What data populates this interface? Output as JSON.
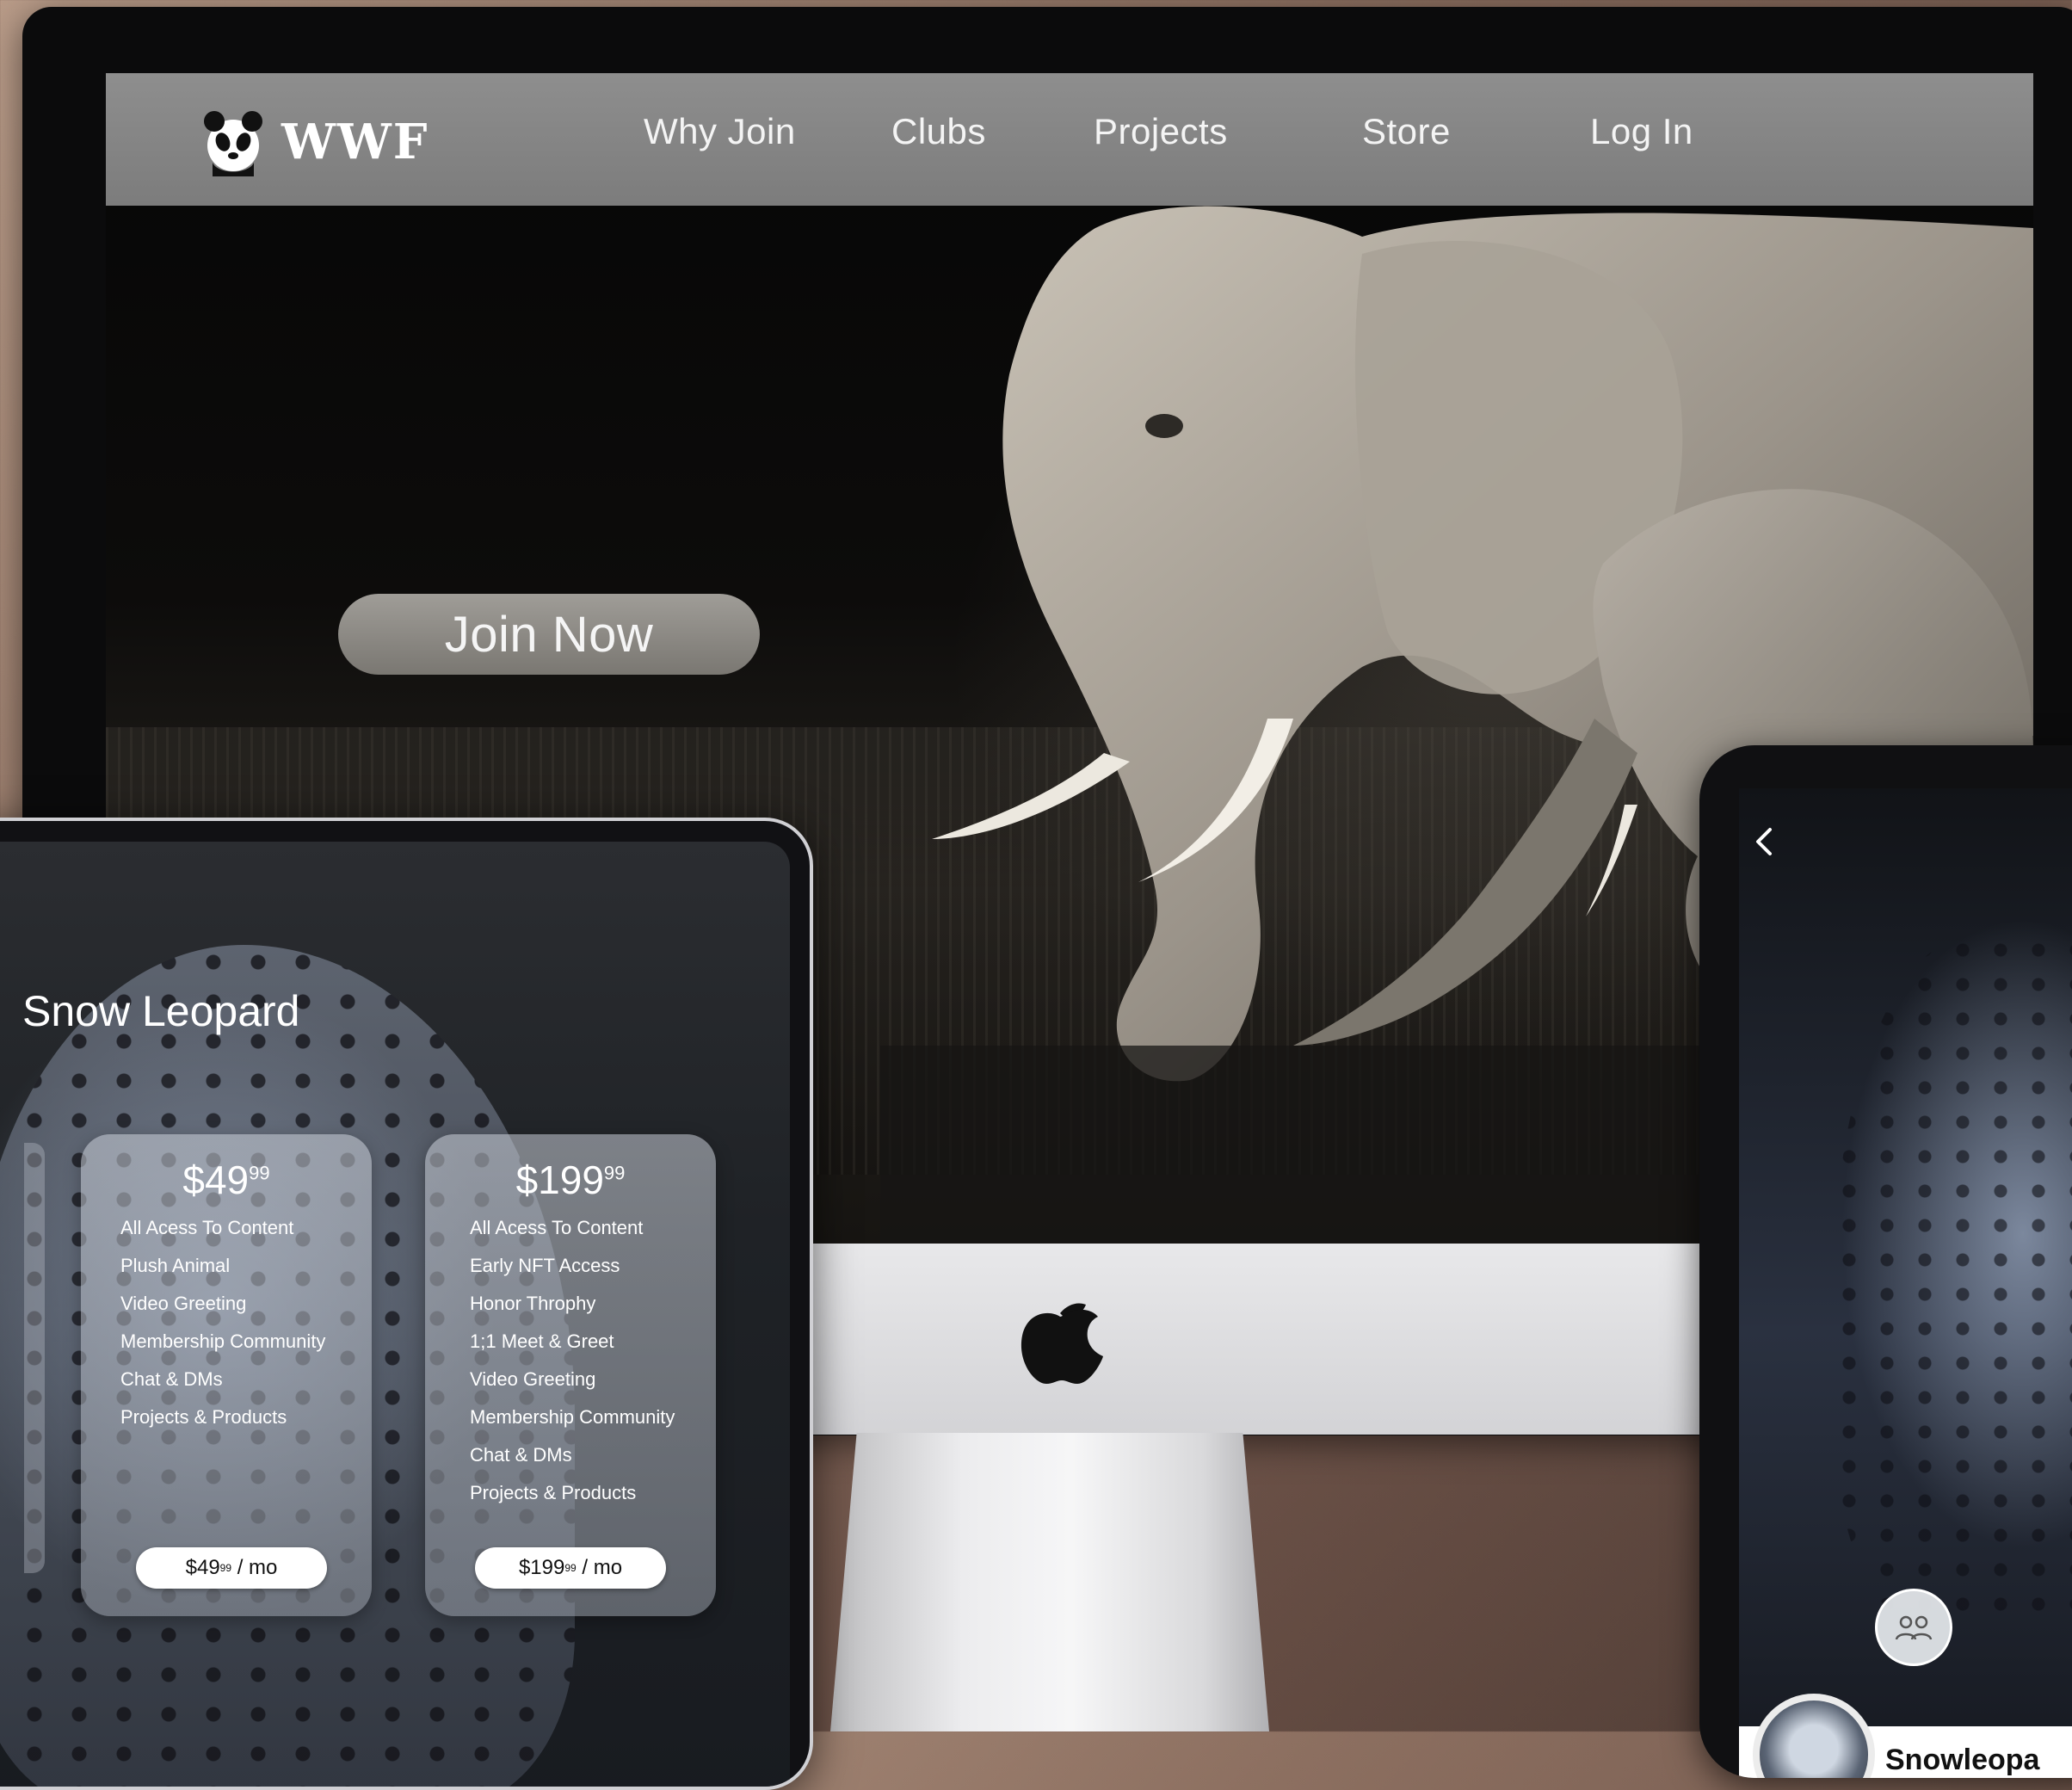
{
  "desktop": {
    "brand": "WWF",
    "nav": [
      "Why Join",
      "Clubs",
      "Projects",
      "Store",
      "Log In"
    ],
    "hero_button": "Join Now"
  },
  "tablet": {
    "title": "Snow Leopard",
    "plans": [
      {
        "price_main": "$49",
        "price_cents": "99",
        "features": [
          "All Acess To Content",
          "Plush Animal",
          "Video Greeting",
          "Membership Community",
          "Chat & DMs",
          "Projects & Products"
        ],
        "cta_main": "$49",
        "cta_cents": "99",
        "cta_suffix": " / mo"
      },
      {
        "price_main": "$199",
        "price_cents": "99",
        "features": [
          "All Acess To Content",
          "Early NFT Access",
          "Honor Throphy",
          "1;1 Meet & Greet",
          "Video Greeting",
          "Membership Community",
          "Chat & DMs",
          "Projects & Products"
        ],
        "cta_main": "$199",
        "cta_cents": "99",
        "cta_suffix": " / mo"
      }
    ]
  },
  "phone": {
    "profile_name": "Snowleopa",
    "icons": [
      "chevron-left-icon",
      "group-icon",
      "chat-icon"
    ]
  },
  "colors": {
    "background": "#8c6f60",
    "navbar": "#8e8e8e",
    "accent_white": "#ffffff"
  }
}
